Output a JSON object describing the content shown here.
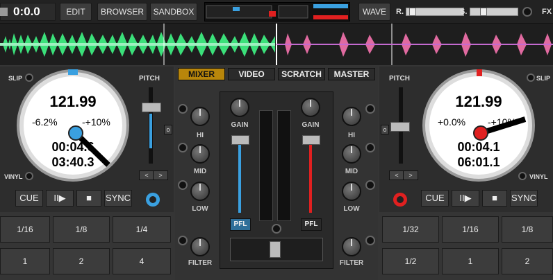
{
  "top": {
    "time": "0:0.0",
    "edit": "EDIT",
    "browser": "BROWSER",
    "sandbox": "SANDBOX",
    "wave": "WAVE",
    "r_label": "R.",
    "s_label": "S.",
    "fx_label": "FX"
  },
  "tabs": {
    "mixer": "MIXER",
    "video": "VIDEO",
    "scratch": "SCRATCH",
    "master": "MASTER"
  },
  "left": {
    "slip": "SLIP",
    "vinyl": "VINYL",
    "pitch": "PITCH",
    "bpm": "121.99",
    "pitch_now": "-6.2%",
    "pitch_range": "-+10%",
    "elapsed": "00:04.6",
    "remain": "03:40.3",
    "cue": "CUE",
    "play": "II▶",
    "stop": "■",
    "sync": "SYNC",
    "nudge_left": "<",
    "nudge_right": ">",
    "zero": "o",
    "loops": [
      "1/16",
      "1/8",
      "1/4",
      "1",
      "2",
      "4"
    ],
    "accent": "#3aa0e0"
  },
  "right": {
    "slip": "SLIP",
    "vinyl": "VINYL",
    "pitch": "PITCH",
    "bpm": "121.99",
    "pitch_now": "+0.0%",
    "pitch_range": "-+10%",
    "elapsed": "00:04.1",
    "remain": "06:01.1",
    "cue": "CUE",
    "play": "II▶",
    "stop": "■",
    "sync": "SYNC",
    "nudge_left": "<",
    "nudge_right": ">",
    "zero": "o",
    "loops": [
      "1/32",
      "1/16",
      "1/8",
      "1/2",
      "1",
      "2"
    ],
    "accent": "#e02020"
  },
  "mixer": {
    "hi": "HI",
    "mid": "MID",
    "low": "LOW",
    "filter": "FILTER",
    "gain": "GAIN",
    "pfl": "PFL"
  }
}
